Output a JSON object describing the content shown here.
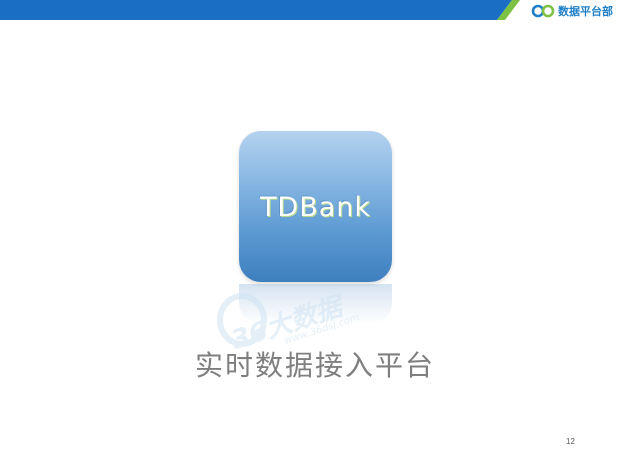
{
  "header": {
    "brand_name": "数据平台部",
    "logo_icon": "infinity-loop-logo",
    "bar_color": "#1a6fc4",
    "accent_color": "#7dc242"
  },
  "slide": {
    "app_icon_label": "TDBank",
    "subtitle": "实时数据接入平台",
    "page_number": "12"
  },
  "watermark": {
    "large_text": "36大数据",
    "url_text": "www.36dsj.com"
  }
}
